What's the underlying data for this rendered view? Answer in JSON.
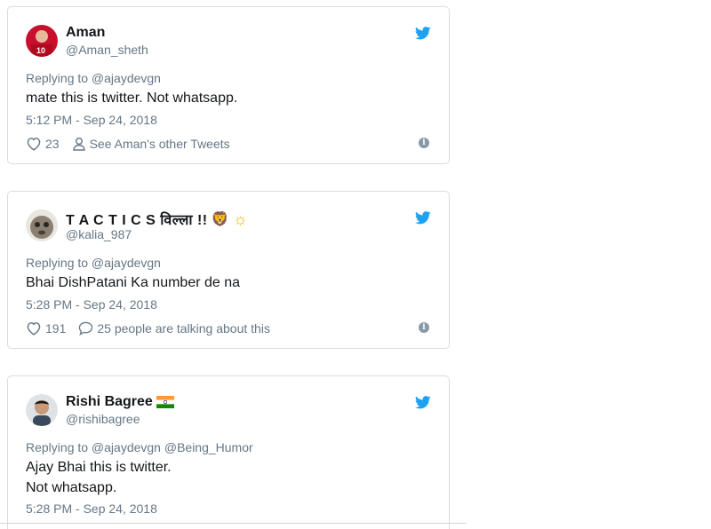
{
  "tweets": [
    {
      "name": "Aman",
      "handle": "@Aman_sheth",
      "replying": "Replying to @ajaydevgn",
      "text_lines": [
        "mate this is twitter. Not whatsapp."
      ],
      "timestamp": "5:12 PM - Sep 24, 2018",
      "likes": "23",
      "secondary_action": "See Aman's other Tweets",
      "secondary_icon": "person-icon"
    },
    {
      "name": "T A C T I C S विल्ला !!",
      "name_emojis": [
        "🦁",
        "☼"
      ],
      "handle": "@kalia_987",
      "replying": "Replying to @ajaydevgn",
      "text_lines": [
        "Bhai DishPatani Ka number de na"
      ],
      "timestamp": "5:28 PM - Sep 24, 2018",
      "likes": "191",
      "secondary_action": "25 people are talking about this",
      "secondary_icon": "comment-icon"
    },
    {
      "name": "Rishi Bagree",
      "name_flag": "india-flag-icon",
      "handle": "@rishibagree",
      "replying": "Replying to @ajaydevgn @Being_Humor",
      "text_lines": [
        "Ajay Bhai this is twitter.",
        "Not whatsapp."
      ],
      "timestamp": "5:28 PM - Sep 24, 2018"
    }
  ],
  "colors": {
    "twitter_blue": "#1da1f2",
    "secondary_text": "#657786",
    "primary_text": "#14171a",
    "border": "#d8dde1"
  }
}
